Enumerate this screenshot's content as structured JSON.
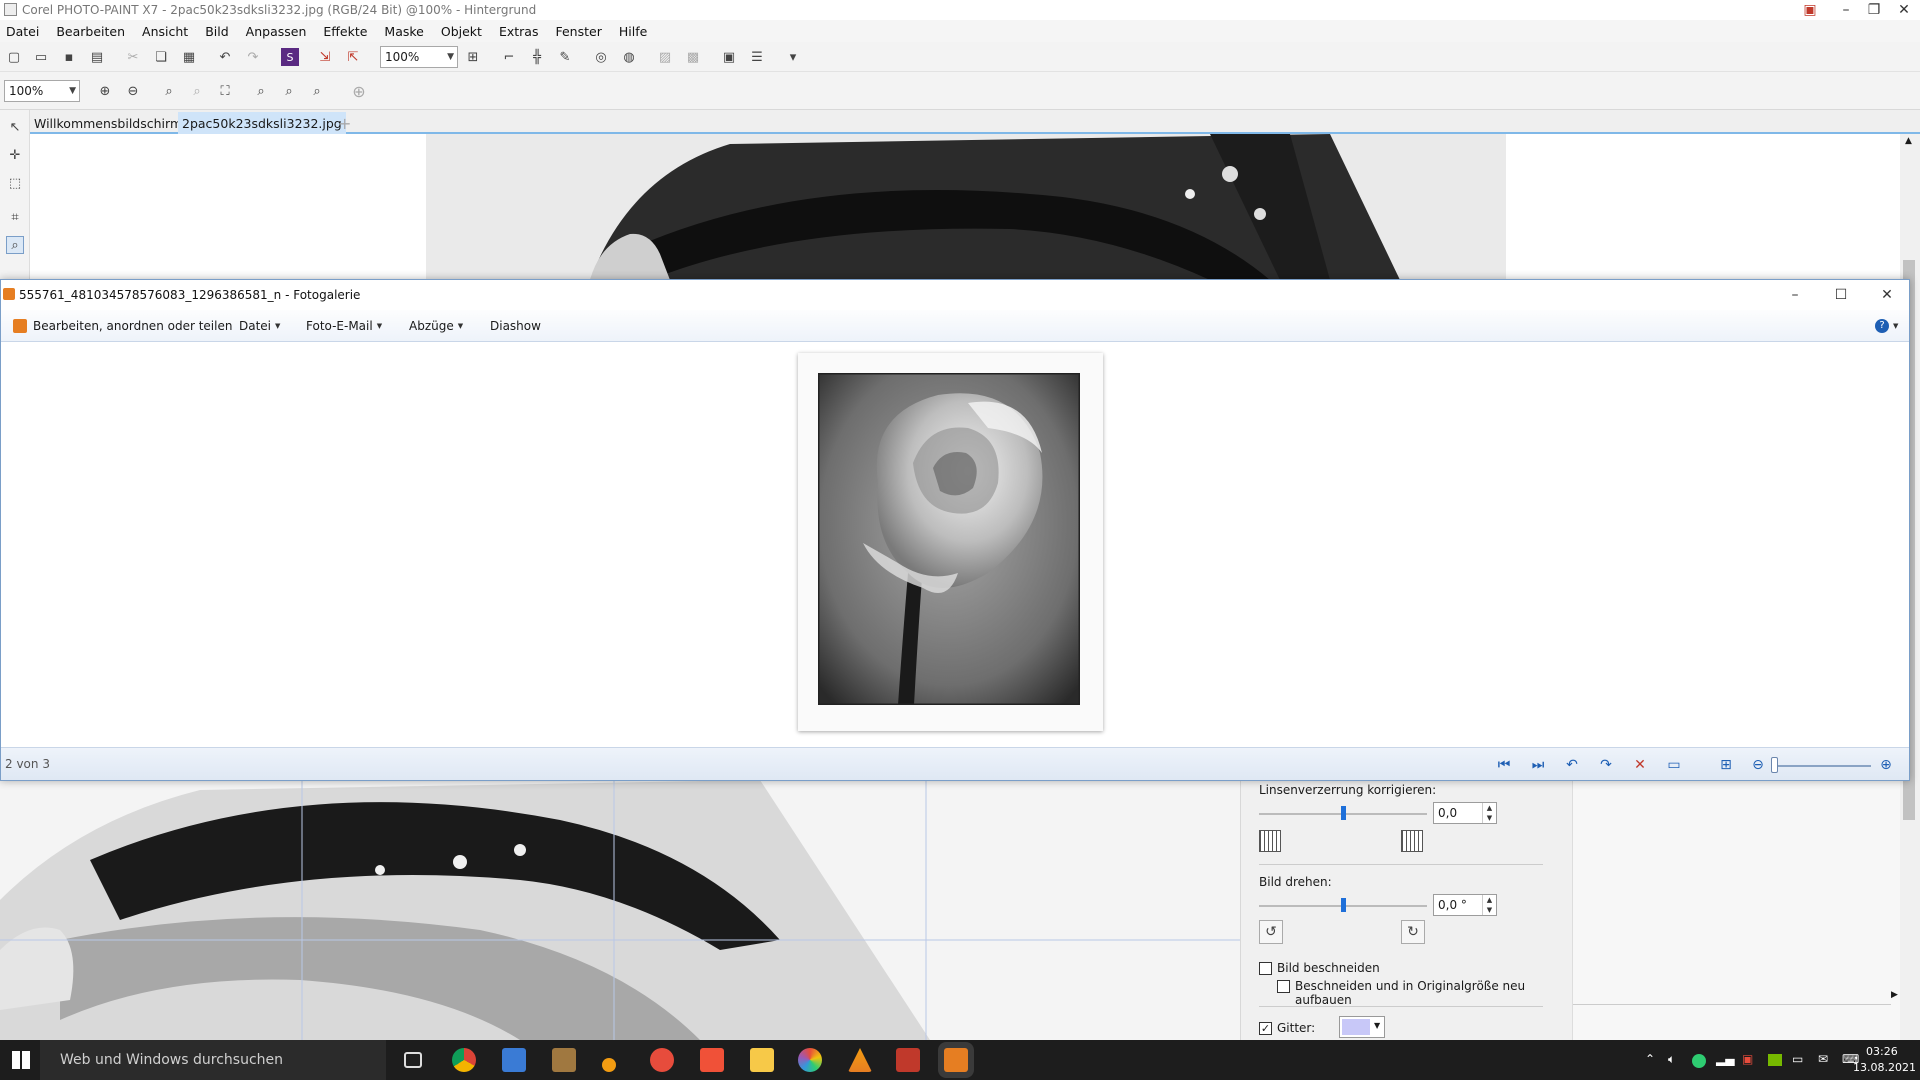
{
  "corel": {
    "title": "Corel PHOTO-PAINT X7 - 2pac50k23sdksli3232.jpg (RGB/24 Bit) @100% - Hintergrund",
    "menu": [
      "Datei",
      "Bearbeiten",
      "Ansicht",
      "Bild",
      "Anpassen",
      "Effekte",
      "Maske",
      "Objekt",
      "Extras",
      "Fenster",
      "Hilfe"
    ],
    "toolbar_zoom": "100%",
    "zoom_level": "100%",
    "tabs": [
      {
        "label": "Willkommensbildschirm",
        "active": false
      },
      {
        "label": "2pac50k23sdksli3232.jpg",
        "active": true
      }
    ],
    "add_tab": "+"
  },
  "panel": {
    "lens_label": "Linsenverzerrung korrigieren:",
    "lens_value": "0,0",
    "rotate_label": "Bild drehen:",
    "rotate_value": "0,0 °",
    "crop_label": "Bild beschneiden",
    "crop_checked": false,
    "crop_rebuild_label": "Beschneiden und in Originalgröße neu aufbauen",
    "crop_rebuild_checked": false,
    "grid_label": "Gitter:",
    "grid_checked": true,
    "grid_color": "#c8c8f8"
  },
  "gallery": {
    "title": "555761_481034578576083_1296386581_n - Fotogalerie",
    "menu": [
      {
        "label": "Bearbeiten, anordnen oder teilen",
        "dropdown": false
      },
      {
        "label": "Datei",
        "dropdown": true
      },
      {
        "label": "Foto-E-Mail",
        "dropdown": true
      },
      {
        "label": "Abzüge",
        "dropdown": true
      },
      {
        "label": "Diashow",
        "dropdown": false
      }
    ],
    "counter": "2 von 3",
    "accent": "#1e5fb4"
  },
  "taskbar": {
    "search_placeholder": "Web und Windows durchsuchen",
    "time": "03:26",
    "date": "13.08.2021"
  }
}
